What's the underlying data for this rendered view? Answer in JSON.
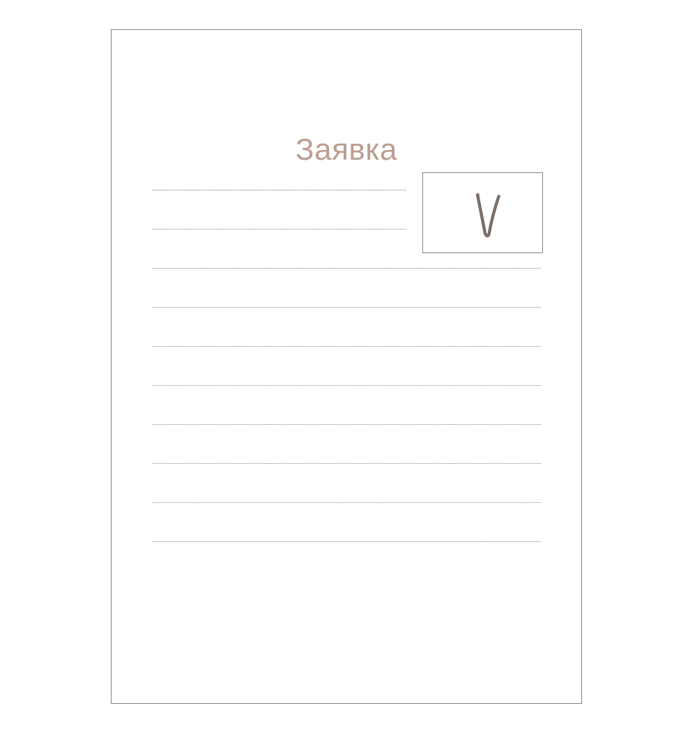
{
  "document": {
    "title": "Заявка",
    "mark": "V",
    "line_count": 10
  },
  "colors": {
    "title": "#bb9e91",
    "mark": "#7a6f68",
    "border": "#8a817c",
    "dots": "#8a817c",
    "background": "#ffffff"
  }
}
